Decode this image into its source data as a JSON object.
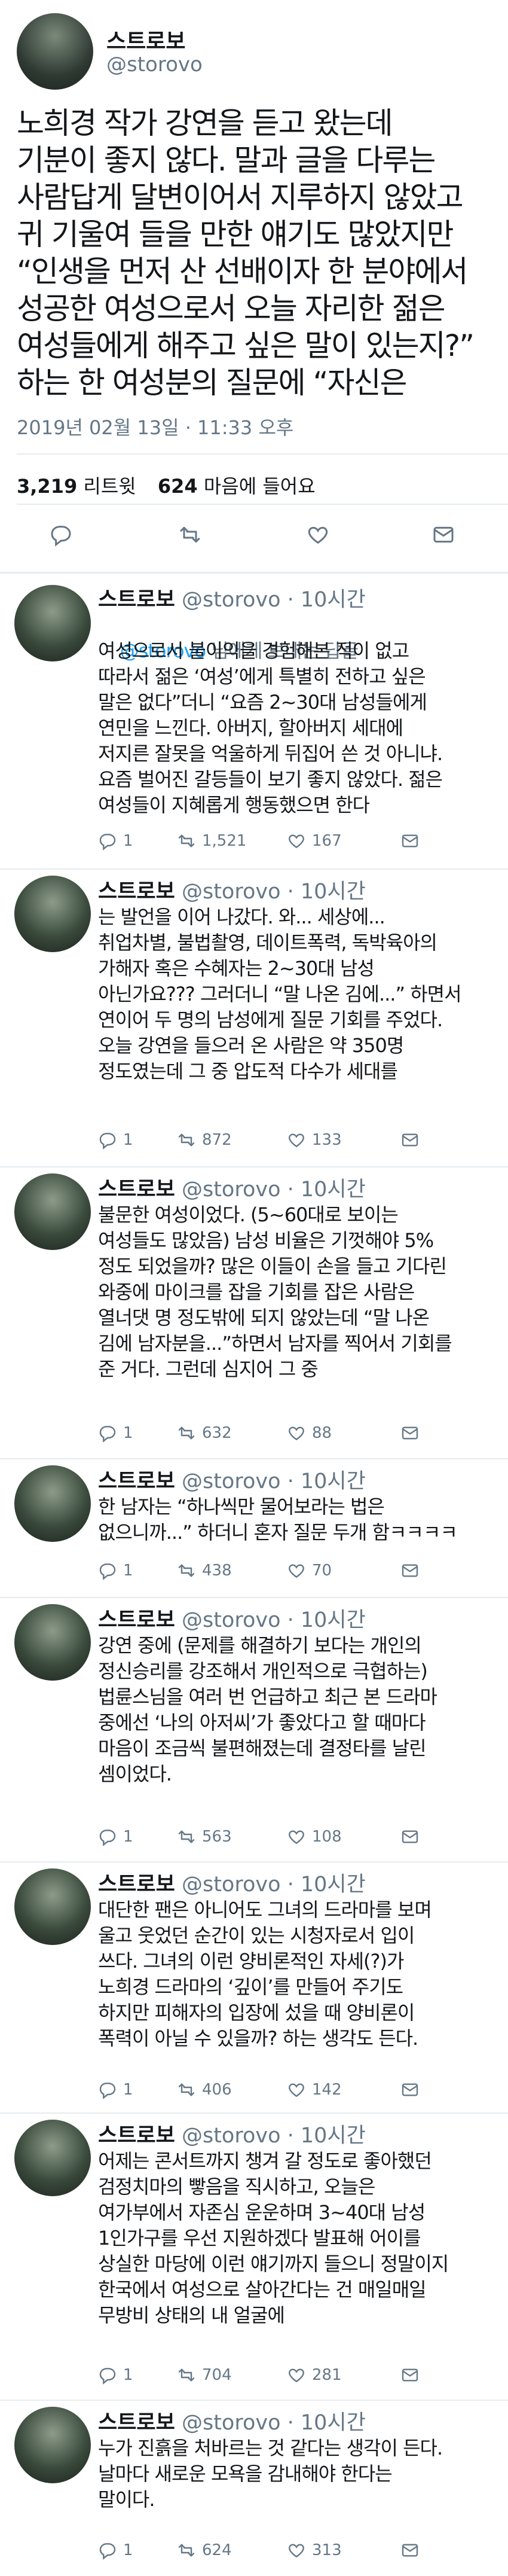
{
  "main": {
    "name": "스트로보",
    "handle": "@storovo",
    "text": "노희경 작가 강연을 듣고 왔는데\n기분이 좋지 않다. 말과 글을 다루는\n사람답게 달변이어서 지루하지 않았고\n귀 기울여 들을 만한 얘기도 많았지만\n“인생을 먼저 산 선배이자 한 분야에서\n성공한 여성으로서 오늘 자리한 젊은\n여성들에게 해주고 싶은 말이 있는지?”\n하는 한 여성분의 질문에 “자신은",
    "timestamp": "2019년 02월 13일 · 11:33 오후",
    "retweets_count": "3,219",
    "retweets_label": "리트윗",
    "likes_count": "624",
    "likes_label": "마음에 들어요"
  },
  "replies": [
    {
      "name": "스트로보",
      "handle": "@storovo · 10시간",
      "mention_prefix": "@storovo",
      "mention_suffix": " 님에게 보내는 답글",
      "text": "여성으로서 불이익을 경험해본 적이 없고\n따라서 젊은 ‘여성’에게 특별히 전하고 싶은\n말은 없다”더니 “요즘 2~30대 남성들에게\n연민을 느낀다. 아버지, 할아버지 세대에\n저지른 잘못을 억울하게 뒤집어 쓴 것 아니냐.\n요즘 벌어진 갈등들이 보기 좋지 않았다. 젊은\n여성들이 지혜롭게 행동했으면 한다",
      "replies": "1",
      "retweets": "1,521",
      "likes": "167"
    },
    {
      "name": "스트로보",
      "handle": "@storovo · 10시간",
      "text": "는 발언을 이어 나갔다. 와... 세상에...\n취업차별, 불법촬영, 데이트폭력, 독박육아의\n가해자 혹은 수혜자는 2~30대 남성\n아닌가요??? 그러더니 “말 나온 김에...” 하면서\n연이어 두 명의 남성에게 질문 기회를 주었다.\n오늘 강연을 들으러 온 사람은 약 350명\n정도였는데 그 중 압도적 다수가 세대를",
      "replies": "1",
      "retweets": "872",
      "likes": "133"
    },
    {
      "name": "스트로보",
      "handle": "@storovo · 10시간",
      "text": "불문한 여성이었다. (5~60대로 보이는\n여성들도 많았음) 남성 비율은 기껏해야 5%\n정도 되었을까? 많은 이들이 손을 들고 기다린\n와중에 마이크를 잡을 기회를 잡은 사람은\n열너댓 명 정도밖에 되지 않았는데 “말 나온\n김에 남자분을...”하면서 남자를 찍어서 기회를\n준 거다. 그런데 심지어 그 중",
      "replies": "1",
      "retweets": "632",
      "likes": "88"
    },
    {
      "name": "스트로보",
      "handle": "@storovo · 10시간",
      "text": "한 남자는 “하나씩만 물어보라는 법은\n없으니까...” 하더니 혼자 질문 두개 함ㅋㅋㅋㅋ",
      "replies": "1",
      "retweets": "438",
      "likes": "70"
    },
    {
      "name": "스트로보",
      "handle": "@storovo · 10시간",
      "text": "강연 중에 (문제를 해결하기 보다는 개인의\n정신승리를 강조해서 개인적으로 극협하는)\n법륜스님을 여러 번 언급하고 최근 본 드라마\n중에선 ‘나의 아저씨’가 좋았다고 할 때마다\n마음이 조금씩 불편해졌는데 결정타를 날린\n셈이었다.",
      "replies": "1",
      "retweets": "563",
      "likes": "108"
    },
    {
      "name": "스트로보",
      "handle": "@storovo · 10시간",
      "text": "대단한 팬은 아니어도 그녀의 드라마를 보며\n울고 웃었던 순간이 있는 시청자로서 입이\n쓰다. 그녀의 이런 양비론적인 자세(?)가\n노희경 드라마의 ‘깊이’를 만들어 주기도\n하지만 피해자의 입장에 섰을 때 양비론이\n폭력이 아닐 수 있을까? 하는 생각도 든다.",
      "replies": "1",
      "retweets": "406",
      "likes": "142"
    },
    {
      "name": "스트로보",
      "handle": "@storovo · 10시간",
      "text": "어제는 콘서트까지 챙겨 갈 정도로 좋아했던\n검정치마의 빻음을 직시하고, 오늘은\n여가부에서 자존심 운운하며 3~40대 남성\n1인가구를 우선 지원하겠다 발표해 어이를\n상실한 마당에 이런 얘기까지 들으니 정말이지\n한국에서 여성으로 살아간다는 건 매일매일\n무방비 상태의 내 얼굴에",
      "replies": "1",
      "retweets": "704",
      "likes": "281"
    },
    {
      "name": "스트로보",
      "handle": "@storovo · 10시간",
      "text": "누가 진흙을 처바르는 것 같다는 생각이 든다.\n날마다 새로운 모욕을 감내해야 한다는\n말이다.",
      "replies": "1",
      "retweets": "624",
      "likes": "313"
    }
  ],
  "colors": {
    "text": "#14171a",
    "muted": "#657786",
    "link": "#1da1f2",
    "divider": "#e6ecf0"
  },
  "icons": {
    "reply": "reply-icon",
    "retweet": "retweet-icon",
    "like": "heart-icon",
    "dm": "envelope-icon"
  }
}
